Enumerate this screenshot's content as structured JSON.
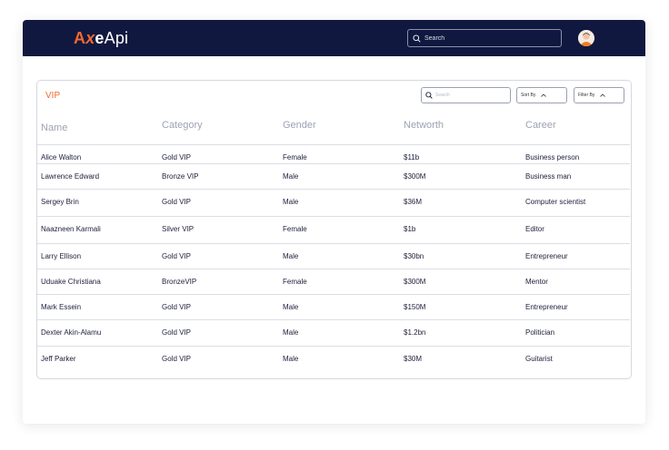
{
  "header": {
    "logo": {
      "a": "A",
      "x": "x",
      "e": "e",
      "api": "Api"
    },
    "search": {
      "placeholder": "Search"
    },
    "avatar_icon": "user-avatar"
  },
  "card": {
    "title": "VIP",
    "search": {
      "placeholder": "Search"
    },
    "sort_label": "Sort By",
    "filter_label": "Filter By"
  },
  "table": {
    "columns": [
      "Name",
      "Category",
      "Gender",
      "Networth",
      "Career"
    ],
    "rows": [
      [
        "Alice Walton",
        "Gold VIP",
        "Female",
        "$11b",
        "Business person"
      ],
      [
        "Lawrence Edward",
        "Bronze VIP",
        "Male",
        "$300M",
        "Business man"
      ],
      [
        "Sergey Brin",
        "Gold VIP",
        "Male",
        "$36M",
        "Computer scientist"
      ],
      [
        "Naazneen Karmali",
        "Silver VIP",
        "Female",
        "$1b",
        "Editor"
      ],
      [
        "Larry Ellison",
        "Gold VIP",
        "Male",
        "$30bn",
        "Entrepreneur"
      ],
      [
        "Uduake Christiana",
        "BronzeVIP",
        "Female",
        "$300M",
        "Mentor"
      ],
      [
        "Mark Essein",
        "Gold VIP",
        "Male",
        "$150M",
        "Entrepreneur"
      ],
      [
        "Dexter Akin-Alamu",
        "Gold VIP",
        "Male",
        "$1.2bn",
        "Politician"
      ],
      [
        "Jeff Parker",
        "Gold VIP",
        "Male",
        "$30M",
        "Guitarist"
      ]
    ]
  },
  "colors": {
    "navbar": "#11183f",
    "accent": "#f26a2e"
  }
}
